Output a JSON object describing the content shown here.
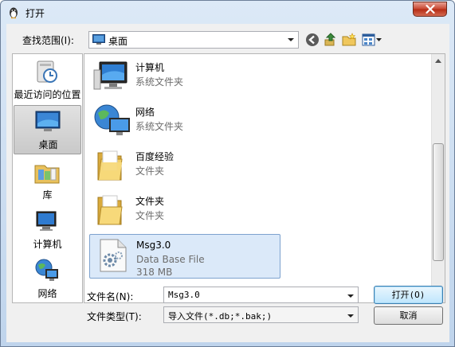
{
  "window": {
    "title": "打开"
  },
  "look_in": {
    "label": "查找范围(I):",
    "value": "桌面"
  },
  "places": [
    {
      "label": "最近访问的位置",
      "icon": "recent-places-icon"
    },
    {
      "label": "桌面",
      "icon": "desktop-icon",
      "selected": true
    },
    {
      "label": "库",
      "icon": "libraries-icon"
    },
    {
      "label": "计算机",
      "icon": "computer-icon"
    },
    {
      "label": "网络",
      "icon": "network-icon"
    }
  ],
  "files": [
    {
      "name": "计算机",
      "type": "系统文件夹",
      "icon": "computer-icon"
    },
    {
      "name": "网络",
      "type": "系统文件夹",
      "icon": "network-icon"
    },
    {
      "name": "百度经验",
      "type": "文件夹",
      "icon": "folder-icon"
    },
    {
      "name": "文件夹",
      "type": "文件夹",
      "icon": "folder-icon"
    },
    {
      "name": "Msg3.0",
      "type": "Data Base File",
      "size": "318 MB",
      "icon": "database-file-icon",
      "selected": true
    }
  ],
  "file_name": {
    "label": "文件名(N):",
    "value": "Msg3.0"
  },
  "file_type": {
    "label": "文件类型(T):",
    "value": "导入文件(*.db;*.bak;)"
  },
  "buttons": {
    "open": "打开(O)",
    "cancel": "取消"
  }
}
